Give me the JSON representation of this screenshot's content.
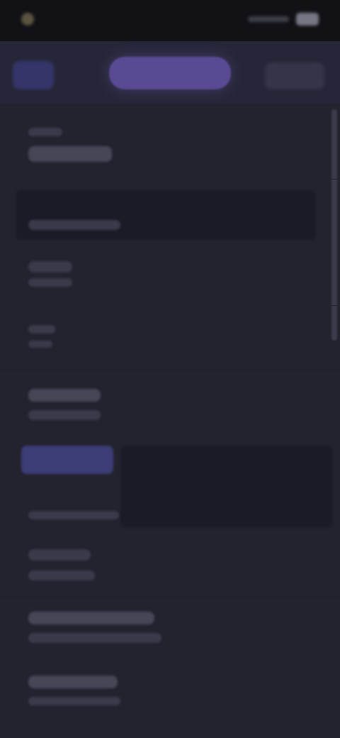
{
  "status_bar": {
    "time": "",
    "battery_label": ""
  },
  "header": {
    "left_label": "",
    "active_tab_label": "",
    "right_label": ""
  },
  "content": {
    "sections": [
      {
        "title": "",
        "subtitle": ""
      },
      {
        "title": "",
        "subtitle": ""
      },
      {
        "title": "",
        "subtitle": ""
      },
      {
        "title": "",
        "subtitle": ""
      },
      {
        "title": "",
        "subtitle": ""
      },
      {
        "title": "",
        "subtitle": ""
      },
      {
        "title": "",
        "subtitle": ""
      },
      {
        "title": "",
        "subtitle": ""
      },
      {
        "title": "",
        "subtitle": ""
      }
    ]
  },
  "colors": {
    "background": "#23232f",
    "header": "#262638",
    "accent": "#5a4a94",
    "muted": "#3a3a4b"
  },
  "icons": {
    "battery": "battery-icon"
  }
}
